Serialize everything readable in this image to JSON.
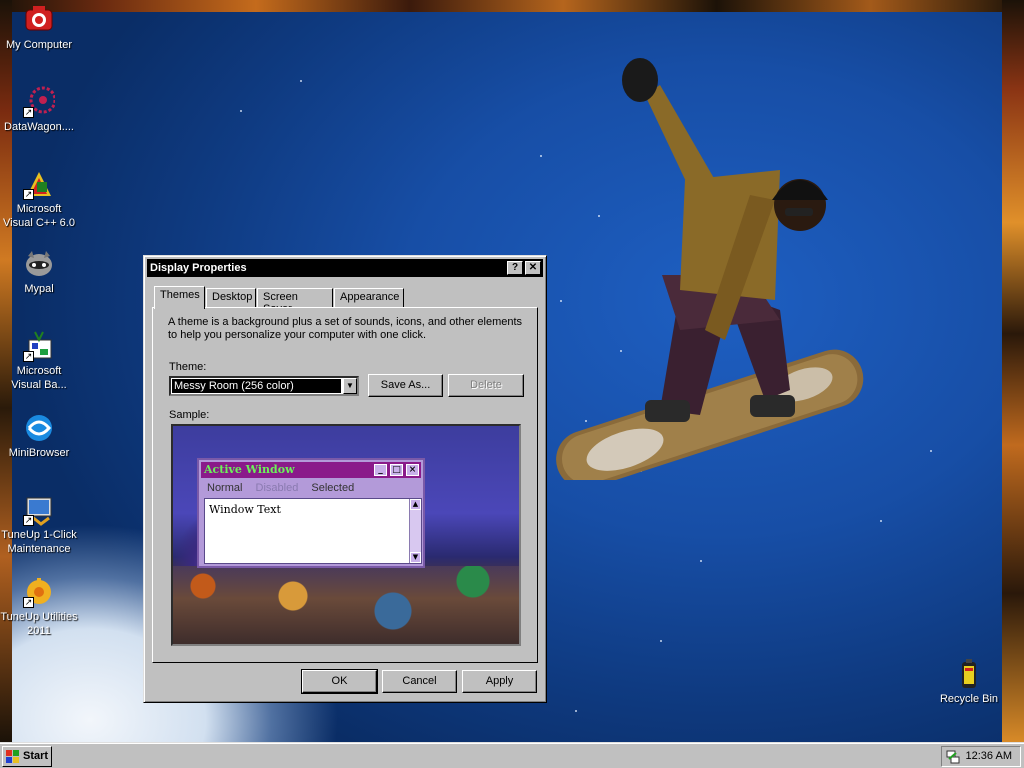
{
  "desktop": {
    "icons": [
      {
        "label": "My Computer",
        "icon": "camera-icon"
      },
      {
        "label": "DataWagon....",
        "icon": "datawagon-icon"
      },
      {
        "label": "Microsoft\nVisual C++ 6.0",
        "icon": "visual-cpp-icon"
      },
      {
        "label": "Mypal",
        "icon": "raccoon-icon"
      },
      {
        "label": "Microsoft\nVisual Ba...",
        "icon": "visual-basic-icon"
      },
      {
        "label": "MiniBrowser",
        "icon": "globe-icon"
      },
      {
        "label": "TuneUp 1-Click\nMaintenance",
        "icon": "tuneup-icon"
      },
      {
        "label": "TuneUp Utilities\n2011",
        "icon": "tuneup-utilities-icon"
      },
      {
        "label": "Recycle Bin",
        "icon": "recycle-bin-icon"
      }
    ]
  },
  "window": {
    "title": "Display Properties",
    "help_btn": "?",
    "close_btn": "✕",
    "tabs": [
      "Themes",
      "Desktop",
      "Screen Saver",
      "Appearance"
    ],
    "active_tab": "Themes",
    "description": "A theme is a background plus a set of sounds, icons, and other elements to help you personalize your computer with one click.",
    "theme_label": "Theme:",
    "theme_value": "Messy Room (256 color)",
    "save_as": "Save As...",
    "delete": "Delete",
    "sample_label": "Sample:",
    "sample": {
      "title": "Active Window",
      "menu": [
        "Normal",
        "Disabled",
        "Selected"
      ],
      "body_text": "Window Text"
    },
    "ok": "OK",
    "cancel": "Cancel",
    "apply": "Apply"
  },
  "taskbar": {
    "start": "Start",
    "clock": "12:36 AM"
  },
  "colors": {
    "sky": "#174ea6",
    "titlebar": "#000000",
    "sample_title": "#8a1a8a",
    "sample_title_text": "#6cf25a"
  }
}
